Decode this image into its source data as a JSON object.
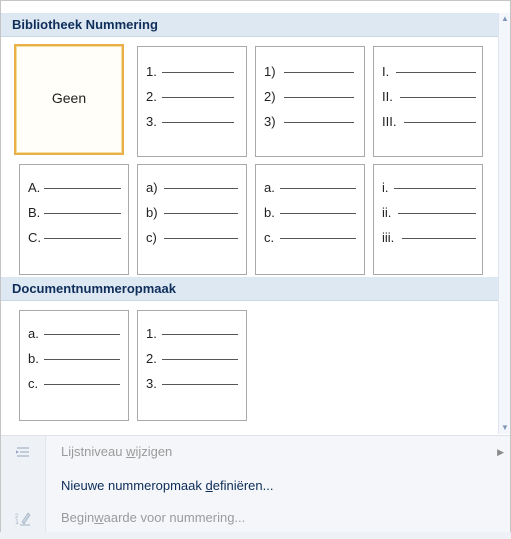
{
  "library": {
    "header": "Bibliotheek Nummering",
    "tiles": [
      {
        "kind": "none",
        "label": "Geen",
        "selected": true
      },
      {
        "kind": "list",
        "markers": [
          "1.",
          "2.",
          "3."
        ]
      },
      {
        "kind": "list",
        "markers": [
          "1)",
          "2)",
          "3)"
        ]
      },
      {
        "kind": "list",
        "markers": [
          "I.",
          "II.",
          "III."
        ]
      },
      {
        "kind": "list",
        "markers": [
          "A.",
          "B.",
          "C."
        ]
      },
      {
        "kind": "list",
        "markers": [
          "a)",
          "b)",
          "c)"
        ]
      },
      {
        "kind": "list",
        "markers": [
          "a.",
          "b.",
          "c."
        ]
      },
      {
        "kind": "list",
        "markers": [
          "i.",
          "ii.",
          "iii."
        ]
      }
    ]
  },
  "document_formats": {
    "header": "Documentnummeropmaak",
    "tiles": [
      {
        "kind": "list",
        "markers": [
          "a.",
          "b.",
          "c."
        ]
      },
      {
        "kind": "list",
        "markers": [
          "1.",
          "2.",
          "3."
        ]
      }
    ]
  },
  "menu": {
    "change_level": {
      "pre": "Lijstniveau ",
      "u": "w",
      "post": "ijzigen",
      "enabled": false,
      "submenu": true
    },
    "define_format": {
      "pre": "Nieuwe nummeropmaak ",
      "u": "d",
      "post": "efiniëren...",
      "enabled": true
    },
    "start_value": {
      "pre": "Begin",
      "u": "w",
      "post": "aarde voor nummering...",
      "enabled": false
    }
  },
  "icons": {
    "change_level": "indent-level-icon",
    "start_value": "set-value-icon",
    "scroll_up": "scroll-up-icon",
    "scroll_down": "scroll-down-icon",
    "submenu": "submenu-arrow-icon"
  },
  "colors": {
    "header_bg": "#dde8f3",
    "header_text": "#0f2e5a",
    "selected_border": "#e9b04a",
    "menu_enabled": "#0b2c58",
    "menu_disabled": "#9b9b9b"
  }
}
